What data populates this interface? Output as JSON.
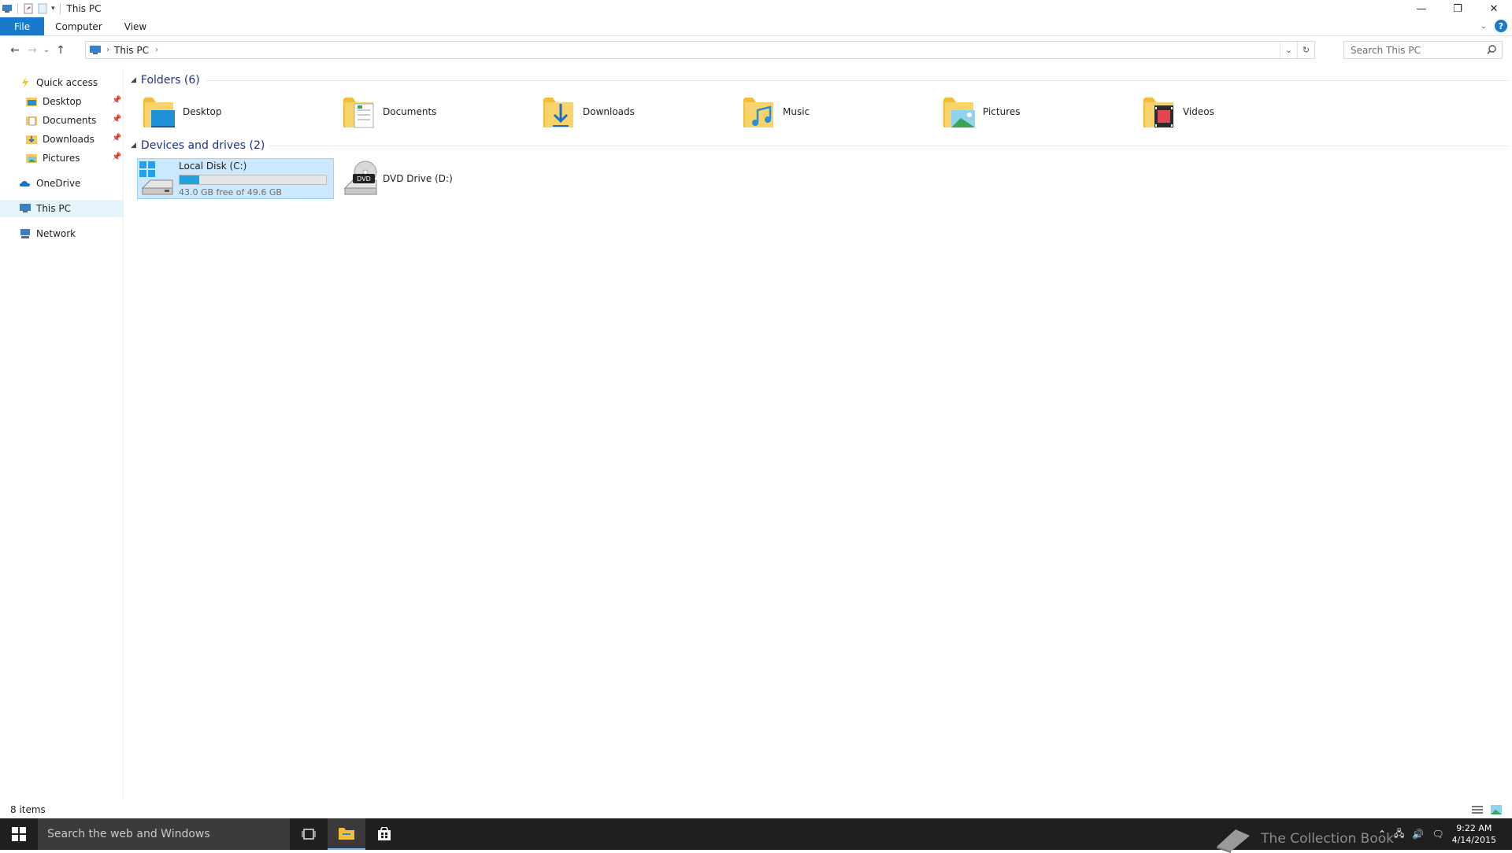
{
  "window": {
    "title": "This PC",
    "minimize_glyph": "—",
    "maximize_glyph": "❐",
    "close_glyph": "✕"
  },
  "ribbon": {
    "tabs": [
      "File",
      "Computer",
      "View"
    ]
  },
  "address": {
    "crumbs": [
      "This PC"
    ],
    "search_placeholder": "Search This PC"
  },
  "nav": {
    "quick_access": "Quick access",
    "pinned": [
      {
        "label": "Desktop",
        "icon": "desktop-folder-icon"
      },
      {
        "label": "Documents",
        "icon": "documents-folder-icon"
      },
      {
        "label": "Downloads",
        "icon": "downloads-folder-icon"
      },
      {
        "label": "Pictures",
        "icon": "pictures-folder-icon"
      }
    ],
    "onedrive": "OneDrive",
    "this_pc": "This PC",
    "network": "Network"
  },
  "content": {
    "folders_header": "Folders (6)",
    "folders": [
      {
        "label": "Desktop",
        "icon": "desktop-folder-icon"
      },
      {
        "label": "Documents",
        "icon": "documents-folder-icon"
      },
      {
        "label": "Downloads",
        "icon": "downloads-folder-icon"
      },
      {
        "label": "Music",
        "icon": "music-folder-icon"
      },
      {
        "label": "Pictures",
        "icon": "pictures-folder-icon"
      },
      {
        "label": "Videos",
        "icon": "videos-folder-icon"
      }
    ],
    "devices_header": "Devices and drives (2)",
    "drives": [
      {
        "label": "Local Disk (C:)",
        "free_text": "43.0 GB free of 49.6 GB",
        "used_fraction": 0.133,
        "icon": "local-disk-icon"
      },
      {
        "label": "DVD Drive (D:)",
        "badge": "DVD",
        "icon": "dvd-drive-icon"
      }
    ]
  },
  "status": {
    "item_count": "8 items"
  },
  "taskbar": {
    "search_placeholder": "Search the web and Windows",
    "watermark": "The Collection Book",
    "time": "9:22 AM",
    "date": "4/14/2015"
  },
  "colors": {
    "accent": "#1979ca",
    "selection": "#cce8ff",
    "bar_fill": "#26a0da",
    "taskbar": "#1f1f1f"
  }
}
